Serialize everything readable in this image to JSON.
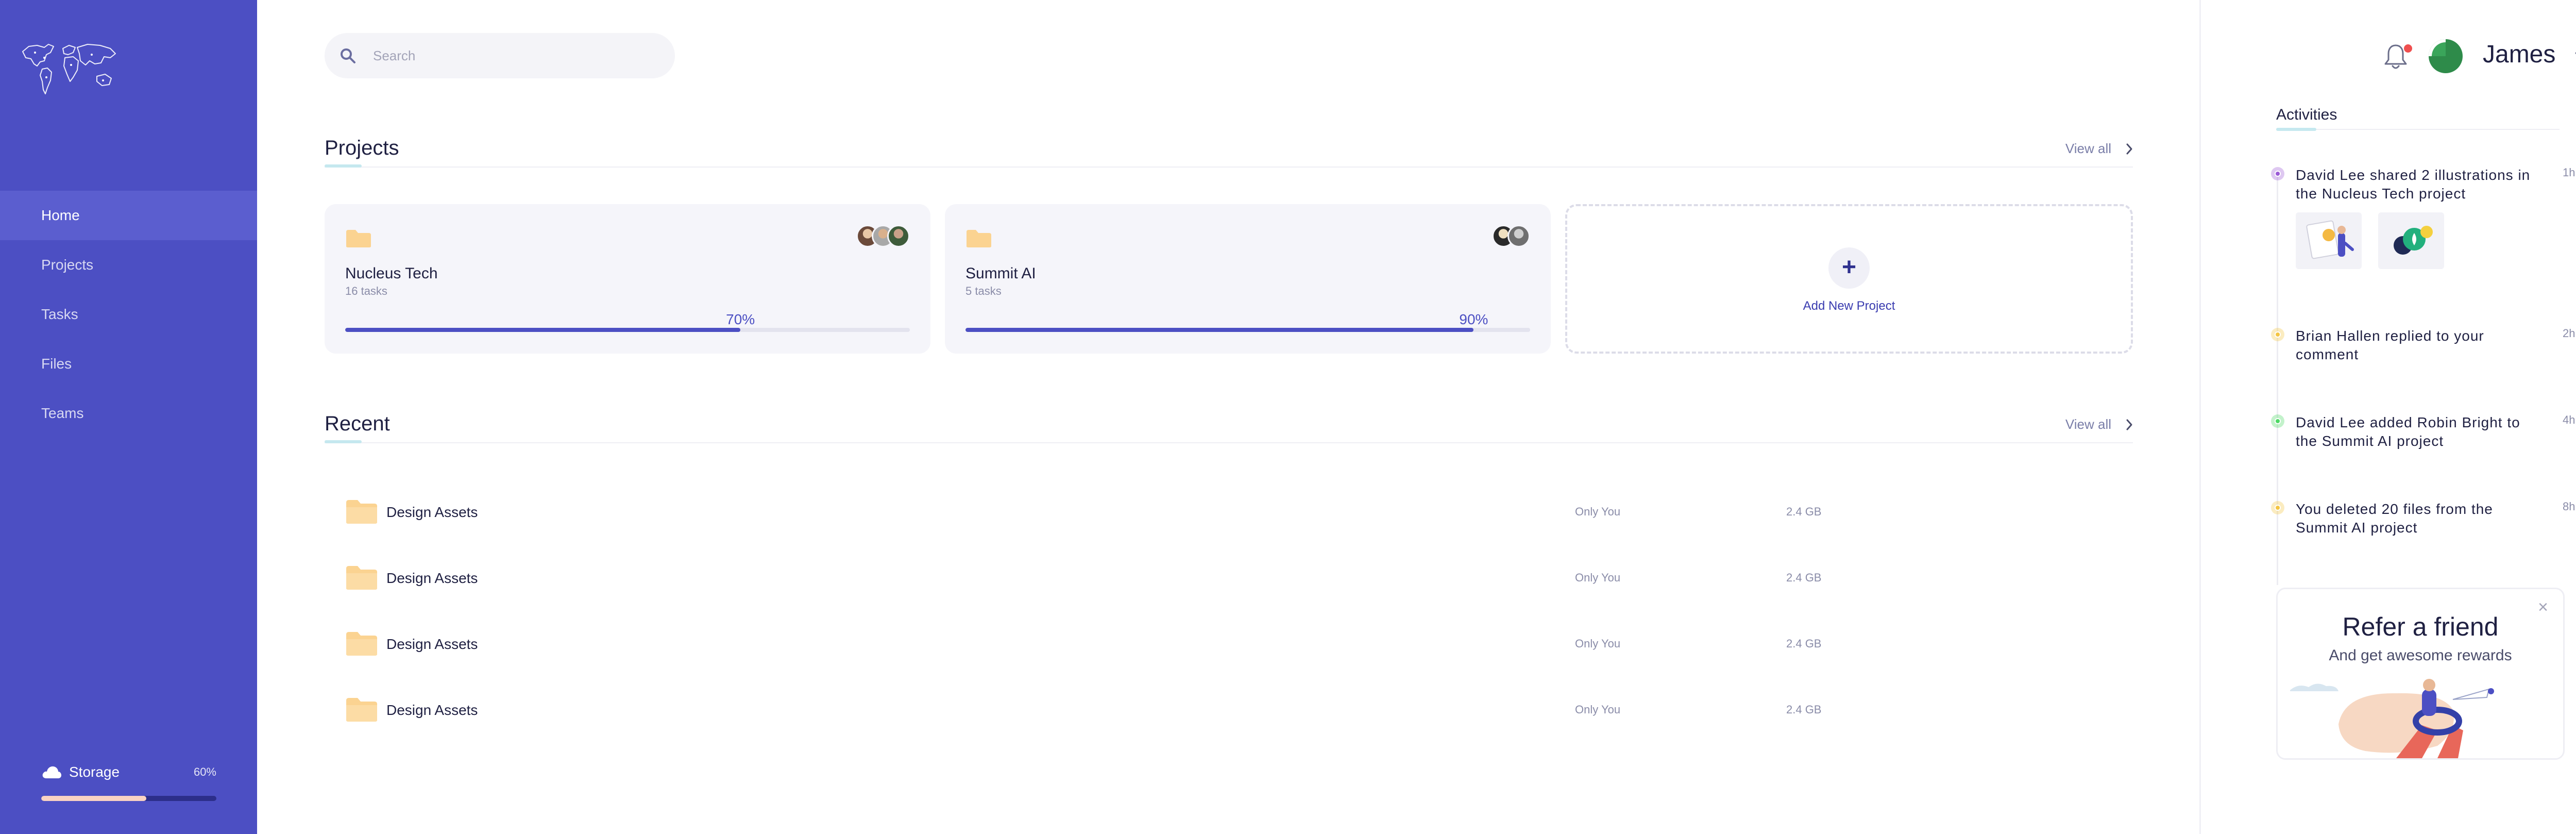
{
  "sidebar": {
    "nav": [
      {
        "label": "Home",
        "active": true
      },
      {
        "label": "Projects",
        "active": false
      },
      {
        "label": "Tasks",
        "active": false
      },
      {
        "label": "Files",
        "active": false
      },
      {
        "label": "Teams",
        "active": false
      }
    ],
    "storage": {
      "label": "Storage",
      "percent_text": "60%",
      "percent": 0.6,
      "icon": "cloud-icon"
    }
  },
  "search": {
    "placeholder": "Search",
    "icon": "search-icon"
  },
  "projects": {
    "title": "Projects",
    "view_all": "View all",
    "cards": [
      {
        "name": "Nucleus Tech",
        "tasks": "16 tasks",
        "progress_text": "70%",
        "progress": 0.7
      },
      {
        "name": "Summit AI",
        "tasks": "5 tasks",
        "progress_text": "90%",
        "progress": 0.9
      }
    ],
    "add_label": "Add New Project"
  },
  "recent": {
    "title": "Recent",
    "view_all": "View all",
    "rows": [
      {
        "name": "Design Assets",
        "access": "Only You",
        "size": "2.4 GB"
      },
      {
        "name": "Design Assets",
        "access": "Only You",
        "size": "2.4 GB"
      },
      {
        "name": "Design Assets",
        "access": "Only You",
        "size": "2.4 GB"
      },
      {
        "name": "Design Assets",
        "access": "Only You",
        "size": "2.4 GB"
      }
    ]
  },
  "user": {
    "name": "James"
  },
  "activities": {
    "title": "Activities",
    "items": [
      {
        "text": "David Lee shared 2 illustrations in the Nucleus Tech project",
        "time": "1h",
        "color": "#9b59d6"
      },
      {
        "text": "Brian Hallen replied to your comment",
        "time": "2h",
        "color": "#f4c542"
      },
      {
        "text": "David Lee added Robin Bright to the Summit AI project",
        "time": "4h",
        "color": "#4cd964"
      },
      {
        "text": "You deleted 20 files from the Summit AI project",
        "time": "8h",
        "color": "#f4c542"
      }
    ]
  },
  "refer": {
    "title": "Refer a friend",
    "subtitle": "And get awesome rewards",
    "close": "×"
  },
  "colors": {
    "sidebar": "#4c4fc3",
    "accent": "#4c4fc3",
    "folder": "#fbd391"
  }
}
